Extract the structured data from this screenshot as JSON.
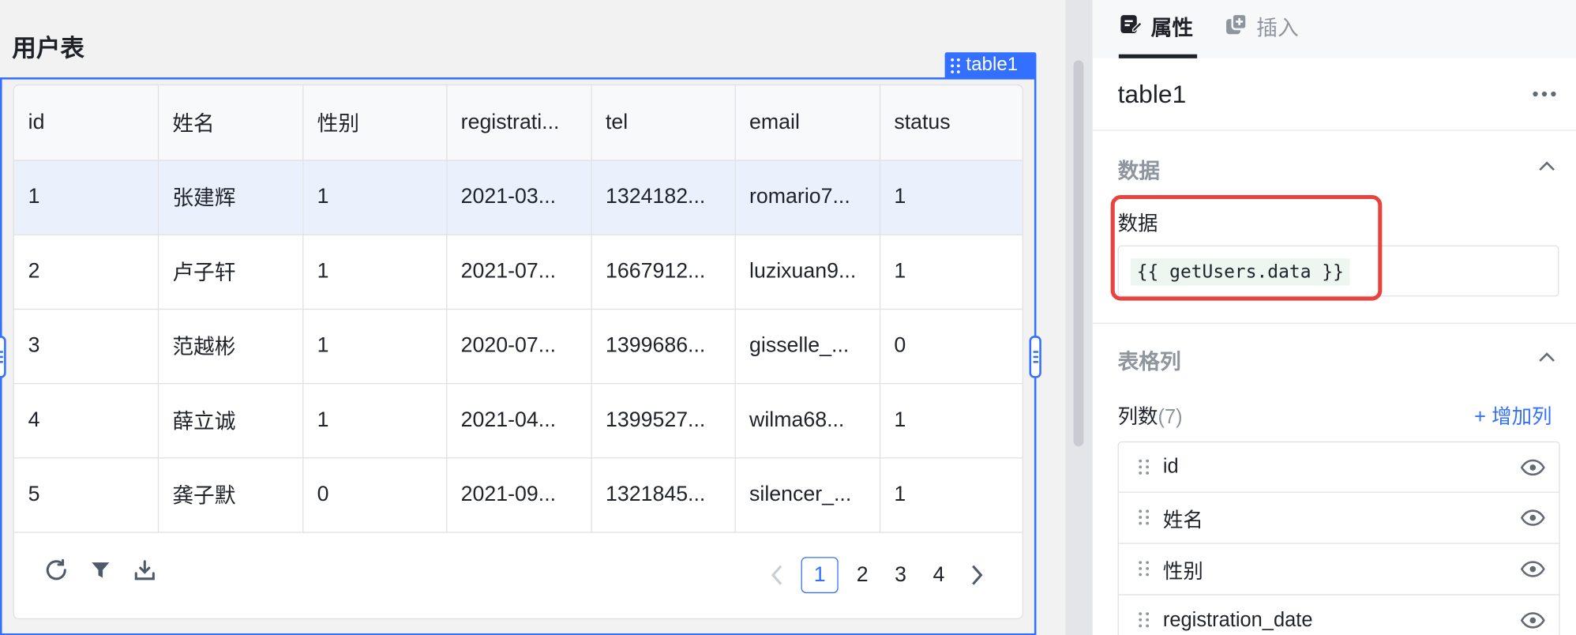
{
  "canvas": {
    "page_title": "用户表",
    "selection_tag": "table1"
  },
  "table": {
    "columns": [
      "id",
      "姓名",
      "性别",
      "registrati...",
      "tel",
      "email",
      "status"
    ],
    "rows": [
      [
        "1",
        "张建辉",
        "1",
        "2021-03...",
        "1324182...",
        "romario7...",
        "1"
      ],
      [
        "2",
        "卢子轩",
        "1",
        "2021-07...",
        "1667912...",
        "luzixuan9...",
        "1"
      ],
      [
        "3",
        "范越彬",
        "1",
        "2020-07...",
        "1399686...",
        "gisselle_...",
        "0"
      ],
      [
        "4",
        "薛立诚",
        "1",
        "2021-04...",
        "1399527...",
        "wilma68...",
        "1"
      ],
      [
        "5",
        "龚子默",
        "0",
        "2021-09...",
        "1321845...",
        "silencer_...",
        "1"
      ]
    ],
    "footer_icons": [
      "refresh-icon",
      "filter-icon",
      "download-icon"
    ],
    "pagination": {
      "pages": [
        "1",
        "2",
        "3",
        "4"
      ],
      "current": "1"
    }
  },
  "panel": {
    "tabs": [
      {
        "label": "属性",
        "icon": "property-edit-icon",
        "active": true
      },
      {
        "label": "插入",
        "icon": "insert-icon",
        "active": false
      }
    ],
    "component_name": "table1",
    "data_section": {
      "title": "数据",
      "field_label": "数据",
      "value": "{{ getUsers.data }}"
    },
    "columns_section": {
      "title": "表格列",
      "count_label": "列数",
      "count": "(7)",
      "add_label": "+ 增加列",
      "items": [
        "id",
        "姓名",
        "性别",
        "registration_date"
      ]
    }
  },
  "colors": {
    "accent": "#3370ff",
    "highlight": "#e8433f",
    "row_highlight": "#ebf0fd"
  }
}
